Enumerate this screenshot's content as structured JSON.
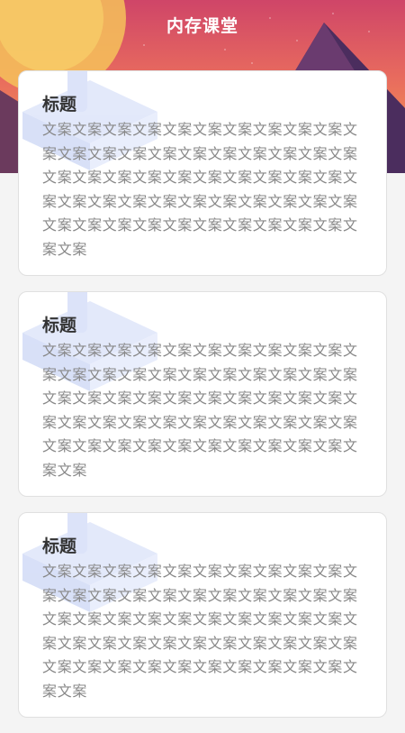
{
  "header": {
    "title": "内存课堂"
  },
  "cards": [
    {
      "title": "标题",
      "body": "文案文案文案文案文案文案文案文案文案文案文案文案文案文案文案文案文案文案文案文案文案文案文案文案文案文案文案文案文案文案文案文案文案文案文案文案文案文案文案文案文案文案文案文案文案文案文案文案文案文案文案文案文案文案"
    },
    {
      "title": "标题",
      "body": "文案文案文案文案文案文案文案文案文案文案文案文案文案文案文案文案文案文案文案文案文案文案文案文案文案文案文案文案文案文案文案文案文案文案文案文案文案文案文案文案文案文案文案文案文案文案文案文案文案文案文案文案文案文案"
    },
    {
      "title": "标题",
      "body": "文案文案文案文案文案文案文案文案文案文案文案文案文案文案文案文案文案文案文案文案文案文案文案文案文案文案文案文案文案文案文案文案文案文案文案文案文案文案文案文案文案文案文案文案文案文案文案文案文案文案文案文案文案文案"
    }
  ]
}
